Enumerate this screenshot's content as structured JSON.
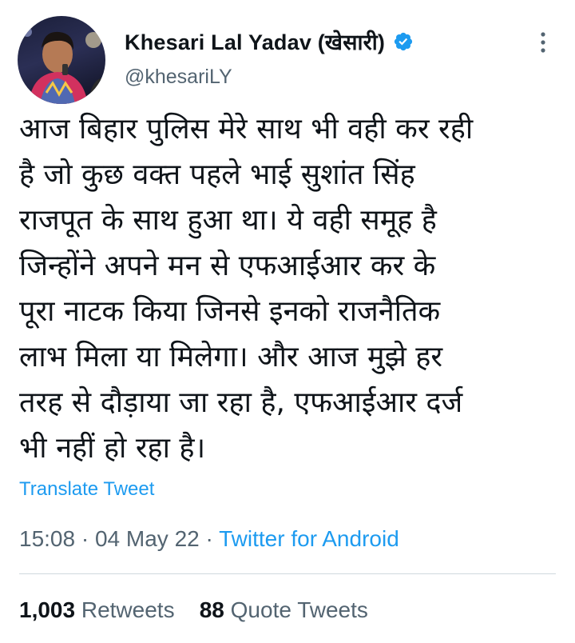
{
  "author": {
    "name": "Khesari Lal Yadav (खेसारी)",
    "handle": "@khesariLY",
    "verified": true,
    "avatar_description_icon": "avatar-photo"
  },
  "tweet": {
    "text": "आज बिहार पुलिस मेरे साथ भी वही कर रही है जो कुछ वक्त पहले भाई सुशांत सिंह राजपूत के साथ हुआ था। ये वही समूह है जिन्होंने अपने मन से एफआईआर कर के पूरा नाटक किया जिनसे इनको राजनैतिक लाभ मिला या मिलेगा। और आज मुझे हर तरह से दौड़ाया जा रहा है, एफआईआर दर्ज भी नहीं हो रहा है।",
    "lines": [
      "आज बिहार पुलिस मेरे साथ भी वही कर रही",
      "है जो कुछ वक्त पहले भाई सुशांत सिंह",
      "राजपूत के साथ हुआ था। ये वही समूह है",
      "जिन्होंने अपने मन से एफआईआर कर के",
      "पूरा नाटक किया जिनसे इनको राजनैतिक",
      "लाभ मिला या मिलेगा। और आज मुझे हर",
      "तरह से दौड़ाया जा रहा है, एफआईआर दर्ज",
      "भी नहीं हो रहा है।"
    ],
    "translate_label": "Translate Tweet"
  },
  "meta": {
    "time": "15:08",
    "separator": "·",
    "date": "04 May 22",
    "source": "Twitter for Android"
  },
  "stats": {
    "retweets_count": "1,003",
    "retweets_label": "Retweets",
    "quotes_count": "88",
    "quotes_label": "Quote Tweets"
  },
  "colors": {
    "accent": "#1d9bf0",
    "text_primary": "#0f1419",
    "text_secondary": "#536471",
    "divider": "#cfd9de"
  }
}
